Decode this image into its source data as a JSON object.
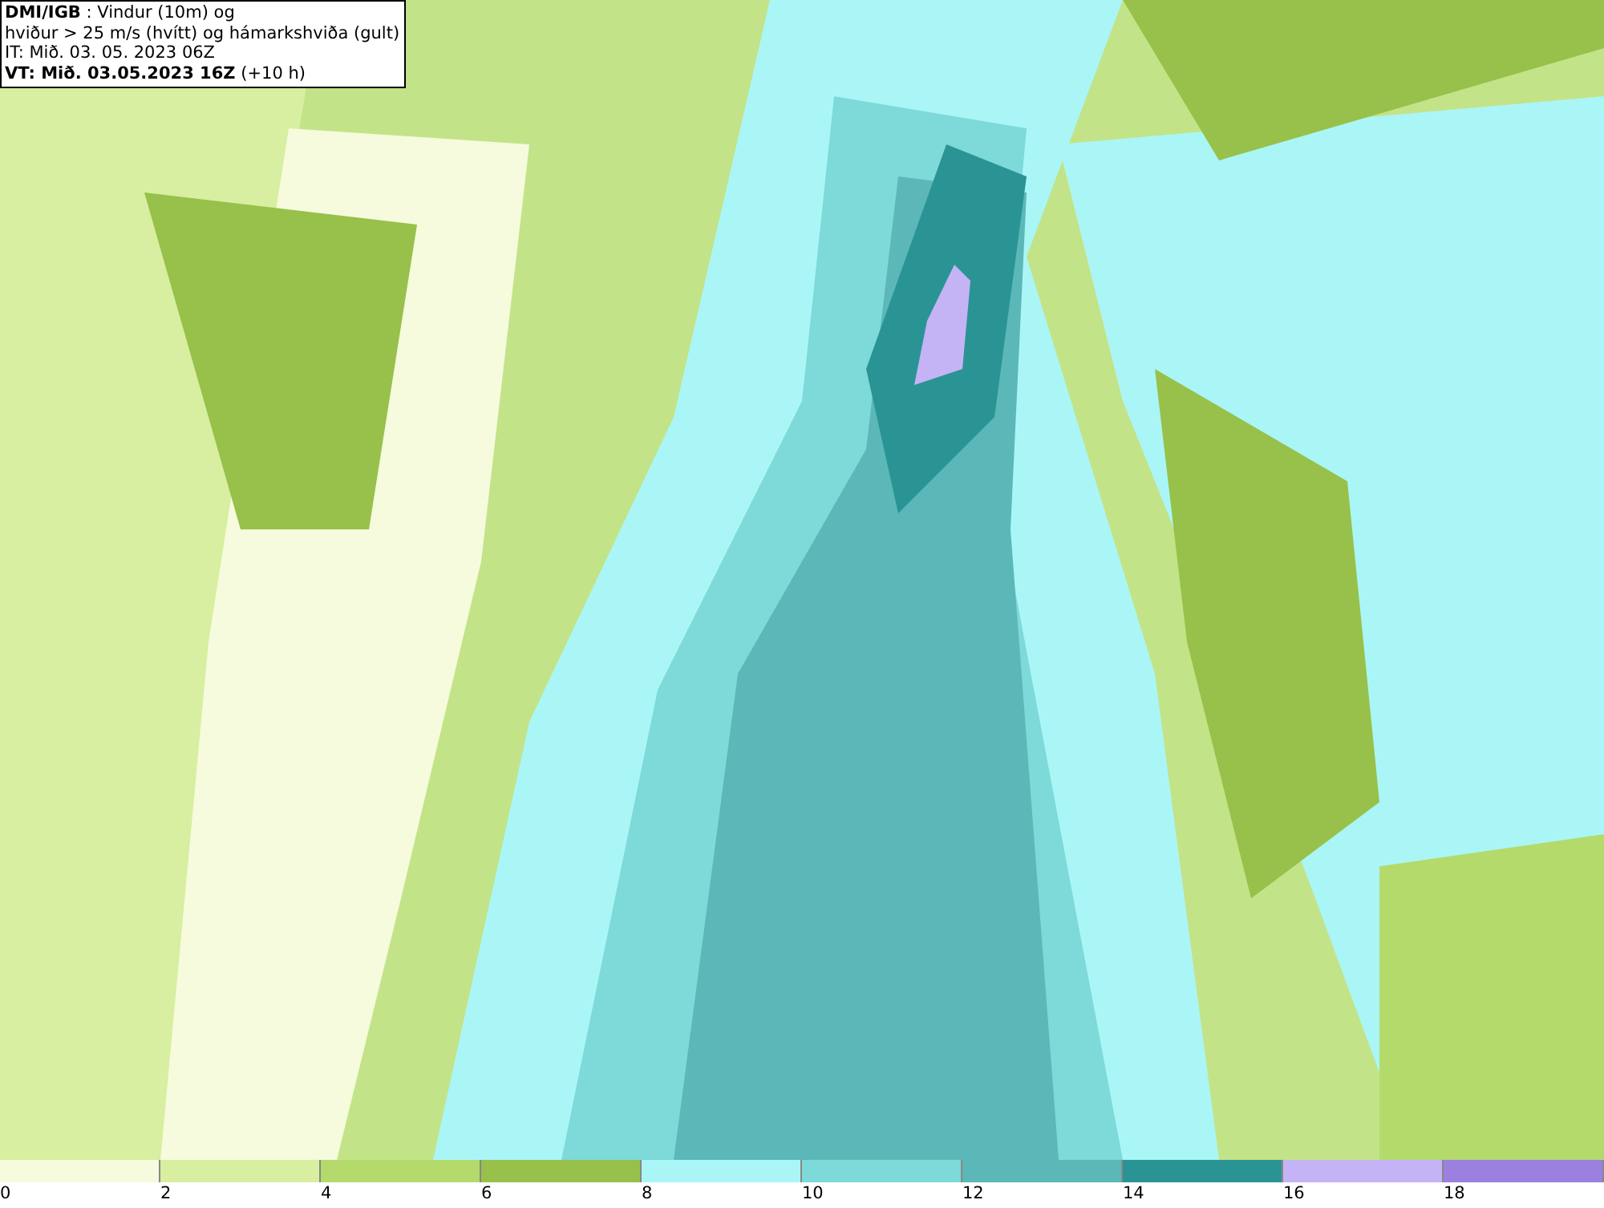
{
  "title_box": {
    "lines": [
      "**DMI/IGB** : Vindur (10m) og",
      "hviður > 25 m/s (hvítt) og hámarkshviða (gult)",
      "IT: Mið. 03. 05. 2023 06Z",
      "**VT: Mið. 03.05.2023 16Z** (+10 h)"
    ]
  },
  "legend": [
    {
      "label": "0",
      "color": "#f5fbdc"
    },
    {
      "label": "2",
      "color": "#d8eea0"
    },
    {
      "label": "4",
      "color": "#b5da6c"
    },
    {
      "label": "6",
      "color": "#97c14a"
    },
    {
      "label": "8",
      "color": "#aaf6f6"
    },
    {
      "label": "10",
      "color": "#7ed9d9"
    },
    {
      "label": "12",
      "color": "#5cb8b8"
    },
    {
      "label": "14",
      "color": "#2a9494"
    },
    {
      "label": "16",
      "color": "#c4b4f5"
    },
    {
      "label": "18",
      "color": "#9b80e0"
    }
  ]
}
